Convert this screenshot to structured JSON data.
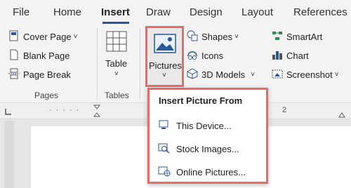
{
  "tabs": [
    "File",
    "Home",
    "Insert",
    "Draw",
    "Design",
    "Layout",
    "References"
  ],
  "pages_group": {
    "items": [
      "Cover Page",
      "Blank Page",
      "Page Break"
    ],
    "label": "Pages"
  },
  "tables_group": {
    "button_label": "Table",
    "label": "Tables"
  },
  "pictures_button": {
    "label": "Pictures"
  },
  "illustrations": {
    "shapes": "Shapes",
    "icons": "Icons",
    "models": "3D Models"
  },
  "smartart_group": {
    "smartart": "SmartArt",
    "chart": "Chart",
    "screenshot": "Screenshot"
  },
  "ruler": {
    "number": "2"
  },
  "dropdown": {
    "title": "Insert Picture From",
    "items": [
      "This Device...",
      "Stock Images...",
      "Online Pictures..."
    ]
  },
  "colors": {
    "accent": "#2b579a",
    "highlight": "#e86c65"
  }
}
